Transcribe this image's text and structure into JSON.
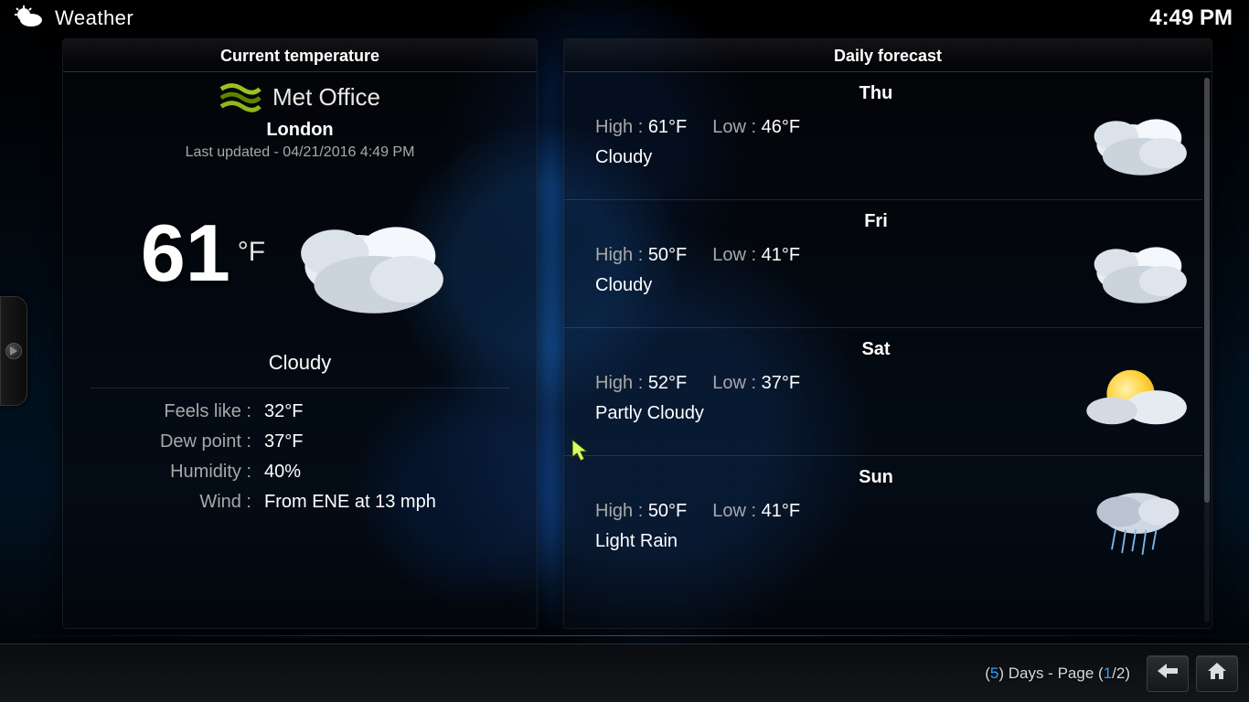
{
  "header": {
    "app_title": "Weather",
    "clock": "4:49 PM"
  },
  "current": {
    "panel_title": "Current temperature",
    "provider_name": "Met Office",
    "location": "London",
    "updated_label": "Last updated - 04/21/2016 4:49 PM",
    "temp_value": "61",
    "temp_unit": "°F",
    "condition": "Cloudy",
    "condition_icon": "cloudy",
    "stats": {
      "feels_label": "Feels like :",
      "feels_value": "32°F",
      "dew_label": "Dew point :",
      "dew_value": "37°F",
      "humidity_label": "Humidity :",
      "humidity_value": "40%",
      "wind_label": "Wind :",
      "wind_value": "From ENE at 13 mph"
    }
  },
  "forecast": {
    "panel_title": "Daily forecast",
    "high_label": "High : ",
    "low_label": "Low : ",
    "days": [
      {
        "name": "Thu",
        "high": "61°F",
        "low": "46°F",
        "cond": "Cloudy",
        "icon": "cloudy"
      },
      {
        "name": "Fri",
        "high": "50°F",
        "low": "41°F",
        "cond": "Cloudy",
        "icon": "cloudy"
      },
      {
        "name": "Sat",
        "high": "52°F",
        "low": "37°F",
        "cond": "Partly Cloudy",
        "icon": "partly-cloudy"
      },
      {
        "name": "Sun",
        "high": "50°F",
        "low": "41°F",
        "cond": "Light Rain",
        "icon": "light-rain"
      }
    ]
  },
  "footer": {
    "status_prefix": "(",
    "status_days": "5",
    "status_mid": ") Days - Page (",
    "status_page_cur": "1",
    "status_page_sep": "/",
    "status_page_total": "2",
    "status_suffix": ")"
  }
}
